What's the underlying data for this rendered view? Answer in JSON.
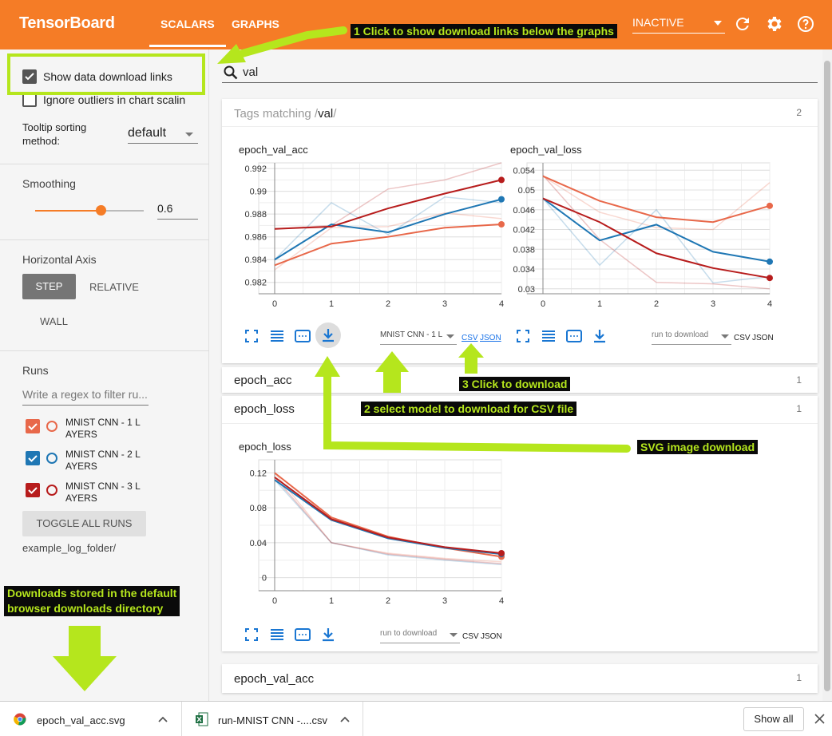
{
  "header": {
    "brand": "TensorBoard",
    "tabs": [
      {
        "label": "SCALARS",
        "active": true
      },
      {
        "label": "GRAPHS",
        "active": false
      }
    ],
    "run_status": "INACTIVE",
    "icons": [
      "refresh-icon",
      "settings-icon",
      "help-icon"
    ],
    "color": "#f57c26"
  },
  "sidebar": {
    "show_download_links": {
      "label": "Show data download links",
      "checked": true
    },
    "ignore_outliers": {
      "label": "Ignore outliers in chart scalin",
      "checked": false
    },
    "tooltip_sorting": {
      "label_line1": "Tooltip sorting",
      "label_line2": "method:",
      "value": "default"
    },
    "smoothing": {
      "title": "Smoothing",
      "value": "0.6",
      "fraction": 0.6
    },
    "horizontal_axis": {
      "title": "Horizontal Axis",
      "options": [
        "STEP",
        "RELATIVE",
        "WALL"
      ],
      "selected": "STEP"
    },
    "runs": {
      "title": "Runs",
      "filter_placeholder": "Write a regex to filter ru...",
      "items": [
        {
          "line1": "MNIST CNN - 1 L",
          "line2": "AYERS",
          "color": "#e8684a",
          "checked": true
        },
        {
          "line1": "MNIST CNN - 2 L",
          "line2": "AYERS",
          "color": "#1f77b4",
          "checked": true
        },
        {
          "line1": "MNIST CNN - 3 L",
          "line2": "AYERS",
          "color": "#b71c1c",
          "checked": true
        }
      ],
      "toggle_label": "TOGGLE ALL RUNS",
      "log_folder": "example_log_folder/"
    }
  },
  "main": {
    "search_value": "val",
    "tags_prefix": "Tags matching /",
    "tags_bold": "val",
    "tags_suffix": "/",
    "tags_count": "2",
    "cards": [
      {
        "title": "epoch_acc",
        "count": "1"
      },
      {
        "title": "epoch_loss",
        "count": "1"
      },
      {
        "title": "epoch_val_acc",
        "count": "1"
      }
    ],
    "download": {
      "selected_model": "MNIST CNN - 1 L",
      "placeholder": "run to download",
      "csv": "CSV",
      "json": "JSON"
    }
  },
  "chart_data": [
    {
      "type": "line",
      "title": "epoch_val_acc",
      "x": [
        0,
        1,
        2,
        3,
        4
      ],
      "xlim": [
        0,
        4
      ],
      "ylim": [
        0.981,
        0.9925
      ],
      "yticks": [
        0.982,
        0.984,
        0.986,
        0.988,
        0.99,
        0.992
      ],
      "ytick_labels": [
        "0.982",
        "0.984",
        "0.986",
        "0.988",
        "0.99",
        "0.992"
      ],
      "series": [
        {
          "values": [
            0.9835,
            0.9854,
            0.986,
            0.9868,
            0.9871
          ],
          "raw": [
            0.9831,
            0.9868,
            0.9869,
            0.9881,
            0.9876
          ],
          "color": "#e8684a"
        },
        {
          "values": [
            0.984,
            0.9871,
            0.9864,
            0.988,
            0.9893
          ],
          "raw": [
            0.984,
            0.989,
            0.9862,
            0.9895,
            0.989
          ],
          "color": "#1f77b4"
        },
        {
          "values": [
            0.9867,
            0.9869,
            0.9885,
            0.9898,
            0.991
          ],
          "raw": [
            0.9867,
            0.987,
            0.9902,
            0.991,
            0.9925
          ],
          "color": "#b71c1c"
        }
      ],
      "grid": true
    },
    {
      "type": "line",
      "title": "epoch_val_loss",
      "x": [
        0,
        1,
        2,
        3,
        4
      ],
      "xlim": [
        0,
        4
      ],
      "ylim": [
        0.029,
        0.0555
      ],
      "yticks": [
        0.03,
        0.034,
        0.038,
        0.042,
        0.046,
        0.05,
        0.054
      ],
      "ytick_labels": [
        "0.03",
        "0.034",
        "0.038",
        "0.042",
        "0.046",
        "0.05",
        "0.054"
      ],
      "series": [
        {
          "values": [
            0.0528,
            0.0478,
            0.0445,
            0.0435,
            0.0468
          ],
          "raw": [
            0.0528,
            0.0455,
            0.0424,
            0.042,
            0.0515
          ],
          "color": "#e8684a"
        },
        {
          "values": [
            0.0483,
            0.0398,
            0.043,
            0.0375,
            0.0355
          ],
          "raw": [
            0.0483,
            0.0348,
            0.046,
            0.0312,
            0.0325
          ],
          "color": "#1f77b4"
        },
        {
          "values": [
            0.0483,
            0.0435,
            0.0372,
            0.0342,
            0.0322
          ],
          "raw": [
            0.053,
            0.04,
            0.0313,
            0.031,
            0.03
          ],
          "color": "#b71c1c"
        }
      ],
      "grid": true
    },
    {
      "type": "line",
      "title": "epoch_loss",
      "x": [
        0,
        1,
        2,
        3,
        4
      ],
      "xlim": [
        0,
        4
      ],
      "ylim": [
        -0.015,
        0.135
      ],
      "yticks": [
        0,
        0.04,
        0.08,
        0.12
      ],
      "ytick_labels": [
        "0",
        "0.04",
        "0.08",
        "0.12"
      ],
      "series": [
        {
          "values": [
            0.12,
            0.069,
            0.047,
            0.034,
            0.024
          ],
          "raw": [
            0.12,
            0.04,
            0.028,
            0.022,
            0.018
          ],
          "color": "#e8684a"
        },
        {
          "values": [
            0.112,
            0.066,
            0.045,
            0.034,
            0.027
          ],
          "raw": [
            0.112,
            0.04,
            0.026,
            0.02,
            0.015
          ],
          "color": "#1f77b4"
        },
        {
          "values": [
            0.115,
            0.067,
            0.046,
            0.035,
            0.028
          ],
          "raw": [
            0.115,
            0.04,
            0.027,
            0.021,
            0.016
          ],
          "color": "#b71c1c"
        }
      ],
      "grid": true
    }
  ],
  "annotations": {
    "a1": "1 Click to show download links below the graphs",
    "a2": "2 select model to download for CSV file",
    "a3": "3 Click to download",
    "svg": "SVG image download",
    "dl_line1": "Downloads stored  in the default",
    "dl_line2": "browser downloads directory",
    "color": "#b5e61d"
  },
  "download_bar": {
    "items": [
      {
        "name": "epoch_val_acc.svg",
        "icon": "chrome-icon"
      },
      {
        "name": "run-MNIST CNN -....csv",
        "icon": "excel-icon"
      }
    ],
    "show_all": "Show all",
    "close_icon": "close-icon"
  }
}
